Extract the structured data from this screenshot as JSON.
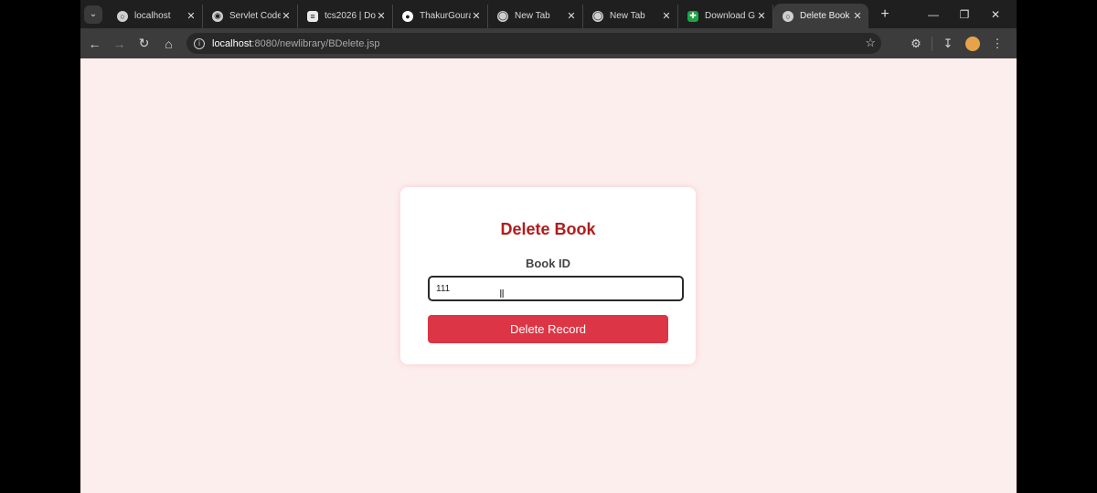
{
  "browser": {
    "tabs": [
      {
        "title": "localhost",
        "icon": "globe-icon"
      },
      {
        "title": "Servlet Code",
        "icon": "site-icon"
      },
      {
        "title": "tcs2026 | Do",
        "icon": "document-icon"
      },
      {
        "title": "ThakurGoura",
        "icon": "github-icon"
      },
      {
        "title": "New Tab",
        "icon": "chrome-icon"
      },
      {
        "title": "New Tab",
        "icon": "chrome-icon"
      },
      {
        "title": "Download G",
        "icon": "download-site-icon"
      },
      {
        "title": "Delete Book",
        "icon": "globe-icon",
        "active": true
      }
    ],
    "new_tab_symbol": "+",
    "address": {
      "host": "localhost",
      "path": ":8080/newlibrary/BDelete.jsp"
    }
  },
  "page": {
    "heading": "Delete Book",
    "field_label": "Book ID",
    "book_id_value": "111",
    "submit_label": "Delete Record"
  },
  "colors": {
    "page_background": "#fdeeee",
    "heading": "#b31b1b",
    "button": "#dc3545"
  }
}
